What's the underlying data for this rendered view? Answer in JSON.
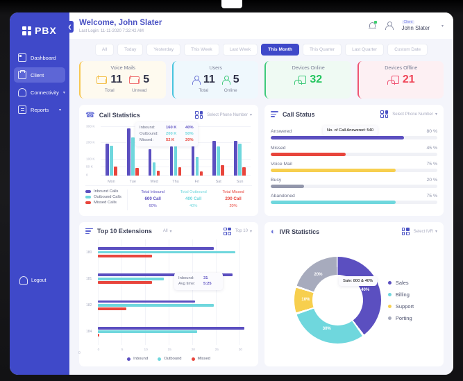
{
  "sidebar": {
    "logo": "PBX",
    "items": [
      {
        "label": "Dashboard",
        "icon": "dashboard-icon",
        "caret": false,
        "active": false
      },
      {
        "label": "Client",
        "icon": "client-icon",
        "caret": false,
        "active": true
      },
      {
        "label": "Connectivity",
        "icon": "connectivity-icon",
        "caret": true,
        "active": false
      },
      {
        "label": "Reports",
        "icon": "reports-icon",
        "caret": true,
        "active": false
      }
    ],
    "logout": "Logout"
  },
  "header": {
    "welcome": "Welcome, John Slater",
    "last_login": "Last Login: 11-11-2020 7:32:42 AM",
    "role": "Client",
    "username": "John Slater",
    "bell_icon": "notification-bell-icon",
    "avatar_icon": "user-avatar-icon"
  },
  "tabs": [
    {
      "label": "All",
      "active": false
    },
    {
      "label": "Today",
      "active": false
    },
    {
      "label": "Yesterday",
      "active": false
    },
    {
      "label": "This Week",
      "active": false
    },
    {
      "label": "Last Week",
      "active": false
    },
    {
      "label": "This Month",
      "active": true
    },
    {
      "label": "This Quarter",
      "active": false
    },
    {
      "label": "Last Quarter",
      "active": false
    },
    {
      "label": "Custom Date",
      "active": false
    }
  ],
  "kpis": [
    {
      "title": "Voice Mails",
      "accent": "#f7c752",
      "cells": [
        {
          "value": "11",
          "label": "Total",
          "color": "#2f3147",
          "icon_color": "#f3c04b"
        },
        {
          "value": "5",
          "label": "Unread",
          "color": "#2f3147",
          "icon_color": "#ef7070"
        }
      ]
    },
    {
      "title": "Users",
      "accent": "#46c4dd",
      "cells": [
        {
          "value": "11",
          "label": "Total",
          "color": "#2f3147",
          "icon_color": "#6e78d6"
        },
        {
          "value": "5",
          "label": "Online",
          "color": "#2f3147",
          "icon_color": "#3ec97a"
        }
      ]
    },
    {
      "title": "Devices Online",
      "accent": "#3ec97a",
      "cells": [
        {
          "value": "32",
          "label": "",
          "color": "#23c55e",
          "icon_color": "#3ec97a"
        }
      ]
    },
    {
      "title": "Devices Offline",
      "accent": "#ef5373",
      "cells": [
        {
          "value": "21",
          "label": "",
          "color": "#ef4457",
          "icon_color": "#ef5373"
        }
      ]
    }
  ],
  "call_statistics": {
    "title": "Call Statistics",
    "select_label": "Select Phone Number",
    "tooltip": {
      "rows": [
        {
          "key": "Inbound:",
          "value": "160 K",
          "pct": "40%",
          "color": "#5b4fc0"
        },
        {
          "key": "Outbound:",
          "value": "200 K",
          "pct": "50%",
          "color": "#6fd7dd"
        },
        {
          "key": "Missed:",
          "value": "52 K",
          "pct": "20%",
          "color": "#e8453c"
        }
      ]
    },
    "legend": [
      {
        "label": "Inbound Calls",
        "color": "#5b4fc0"
      },
      {
        "label": "Outbound Calls",
        "color": "#6fd7dd"
      },
      {
        "label": "Missed Calls",
        "color": "#e8453c"
      }
    ],
    "totals": [
      {
        "title": "Total Inbound",
        "value": "600 Call",
        "pct": "60%",
        "color": "#5b4fc0"
      },
      {
        "title": "Total Outbound",
        "value": "400  Call",
        "pct": "40%",
        "color": "#6fd7dd"
      },
      {
        "title": "Total Missed",
        "value": "200 Call",
        "pct": "20%",
        "color": "#e8453c"
      }
    ]
  },
  "call_status": {
    "title": "Call Status",
    "select_label": "Select Phone Number",
    "tooltip": "No. of Call Answered: 540",
    "rows": [
      {
        "label": "Answered",
        "pct": "80 %",
        "value": 80,
        "color": "#5b4fc0"
      },
      {
        "label": "Missed",
        "pct": "45 %",
        "value": 45,
        "color": "#e8453c"
      },
      {
        "label": "Voice Mail",
        "pct": "75 %",
        "value": 75,
        "color": "#f7cf4e"
      },
      {
        "label": "Busy",
        "pct": "20 %",
        "value": 20,
        "color": "#9397ab"
      },
      {
        "label": "Abandoned",
        "pct": "75 %",
        "value": 75,
        "color": "#6fd7dd"
      }
    ]
  },
  "extensions": {
    "title": "Top 10 Extensions",
    "filter_label": "All",
    "top_label": "Top 10",
    "tooltip": {
      "rows": [
        {
          "key": "Inbound:",
          "value": "31"
        },
        {
          "key": "Avg time:",
          "value": "5:25"
        }
      ]
    },
    "legend": [
      {
        "label": "Inbound",
        "color": "#5b4fc0"
      },
      {
        "label": "Outbound",
        "color": "#6fd7dd"
      },
      {
        "label": "Missed",
        "color": "#e8453c"
      }
    ]
  },
  "ivr": {
    "title": "IVR Statistics",
    "select_label": "Select IVR",
    "tooltip": "Sale:  800 & 40%",
    "legend": [
      {
        "label": "Sales",
        "color": "#5b4fc0"
      },
      {
        "label": "Billing",
        "color": "#6fd7dd"
      },
      {
        "label": "Support",
        "color": "#f7cf4e"
      },
      {
        "label": "Porting",
        "color": "#a7abbd"
      }
    ]
  },
  "chart_data": [
    {
      "type": "bar",
      "title": "Call Statistics",
      "xlabel": "",
      "ylabel": "",
      "categories": [
        "Mon",
        "Tue",
        "Wed",
        "Thu",
        "Fri",
        "Sat",
        "Sun"
      ],
      "yticks": [
        "0",
        "50 K",
        "100 K",
        "200 K",
        "300 K"
      ],
      "ylim": [
        0,
        320000
      ],
      "grid": true,
      "legend_position": "bottom",
      "series": [
        {
          "name": "Inbound Calls",
          "color": "#5b4fc0",
          "values": [
            198000,
            290000,
            163000,
            178000,
            190000,
            215000,
            215000
          ]
        },
        {
          "name": "Outbound Calls",
          "color": "#6fd7dd",
          "values": [
            182000,
            235000,
            80000,
            185000,
            115000,
            178000,
            198000
          ]
        },
        {
          "name": "Missed Calls",
          "color": "#e8453c",
          "values": [
            55000,
            48000,
            31000,
            52000,
            25000,
            63000,
            50000
          ]
        }
      ]
    },
    {
      "type": "bar",
      "title": "Call Status",
      "orientation": "horizontal",
      "categories": [
        "Answered",
        "Missed",
        "Voice Mail",
        "Busy",
        "Abandoned"
      ],
      "values": [
        80,
        45,
        75,
        20,
        75
      ],
      "unit": "%",
      "ylim": [
        0,
        100
      ],
      "grid": false
    },
    {
      "type": "bar",
      "title": "Top 10 Extensions",
      "orientation": "horizontal",
      "categories": [
        "180",
        "181",
        "182",
        "184"
      ],
      "xticks": [
        "0",
        "5",
        "10",
        "15",
        "20",
        "25",
        "30"
      ],
      "xlim": [
        0,
        32
      ],
      "grid": true,
      "legend_position": "bottom",
      "series": [
        {
          "name": "Inbound",
          "color": "#5b4fc0",
          "values": [
            24.5,
            28.5,
            20.5,
            31
          ]
        },
        {
          "name": "Outbound",
          "color": "#6fd7dd",
          "values": [
            29,
            14,
            24.5,
            21
          ]
        },
        {
          "name": "Missed",
          "color": "#e8453c",
          "values": [
            11.5,
            11.5,
            6,
            0.3
          ]
        }
      ]
    },
    {
      "type": "pie",
      "title": "IVR Statistics",
      "labels": [
        "Sales",
        "Billing",
        "Support",
        "Porting"
      ],
      "values": [
        40,
        30,
        10,
        20
      ],
      "colors": [
        "#5b4fc0",
        "#6fd7dd",
        "#f7cf4e",
        "#a7abbd"
      ],
      "slice_labels": [
        "40%",
        "30%",
        "10%",
        "20%"
      ],
      "legend_position": "right",
      "donut": true
    }
  ]
}
